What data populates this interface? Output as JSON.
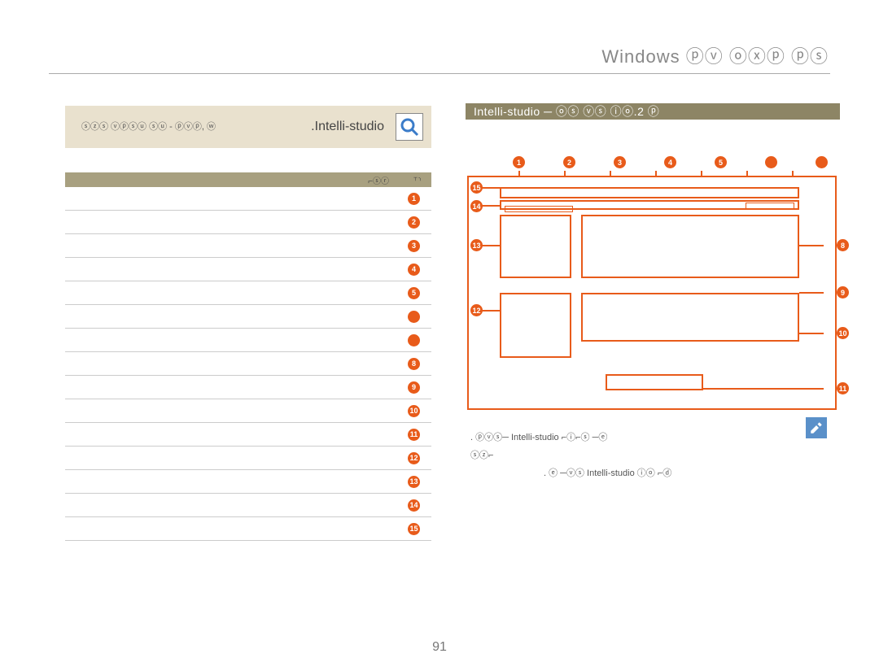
{
  "header": {
    "title": "Windows ⓟⓥ ⓞⓧⓟ ⓟⓢ"
  },
  "left": {
    "banner_small": "ⓢⓩⓢ ⓥⓟⓢⓤ ⓢⓤ - ⓟⓥⓟ, ⓦ",
    "banner_label": ".Intelli-studio",
    "table_headers": {
      "col1": "⌐ⓢⓡ",
      "col2": "⸆⸃"
    }
  },
  "right": {
    "section_title": "Intelli-studio ─ ⓞⓢ ⓥⓢ ⓘⓞ.2 ⓟ",
    "markers": [
      "1",
      "2",
      "3",
      "4",
      "5",
      "",
      "",
      "8",
      "9",
      "10",
      "11",
      "12",
      "13",
      "14",
      "15"
    ],
    "note1": ". ⓟⓥⓢ─ Intelli-studio ⌐ⓘ⌐ⓢ ─ⓔ",
    "note2": "ⓢⓩ⌐",
    "note3": ". ⓔ ─ⓥⓢ   Intelli-studio  ⓘⓞ  ⌐ⓓ"
  },
  "page_number": "91",
  "badges": [
    "1",
    "2",
    "3",
    "4",
    "5",
    "",
    "",
    "8",
    "9",
    "10",
    "11",
    "12",
    "13",
    "14",
    "15"
  ]
}
